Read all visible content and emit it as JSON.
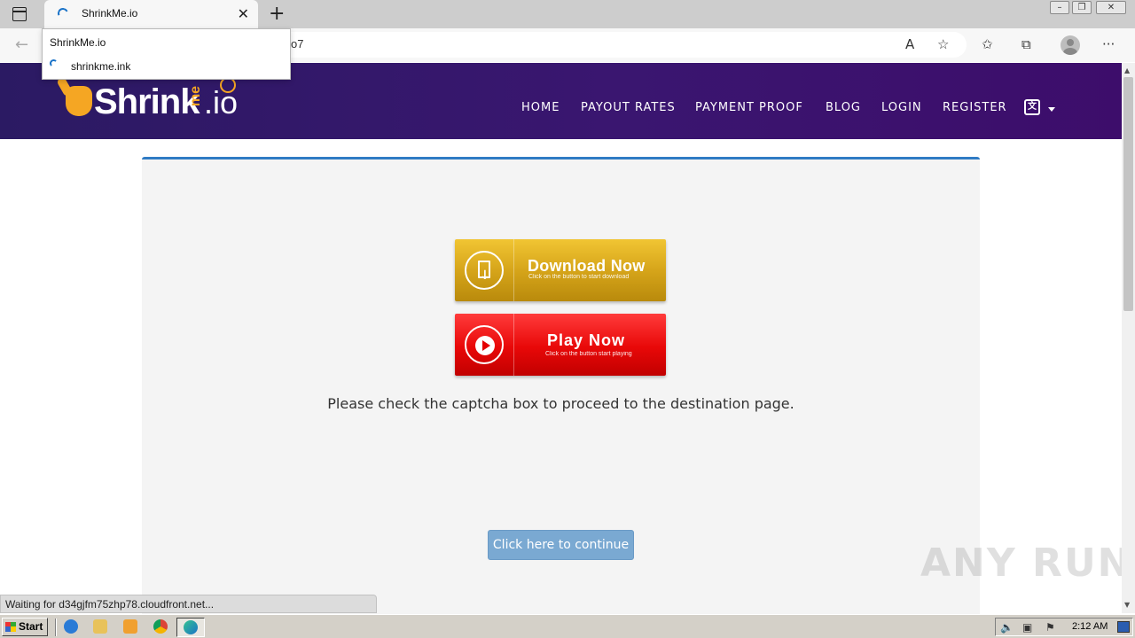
{
  "browser": {
    "tab_title": "ShrinkMe.io",
    "url_fragment": "o7",
    "tooltip": {
      "title": "ShrinkMe.io",
      "domain": "shrinkme.ink"
    },
    "status_text": "Waiting for d34gjfm75zhp78.cloudfront.net..."
  },
  "site": {
    "logo": {
      "main": "Shrink",
      "me": "me",
      "suffix": ".io"
    },
    "nav": [
      "HOME",
      "PAYOUT RATES",
      "PAYMENT PROOF",
      "BLOG",
      "LOGIN",
      "REGISTER"
    ],
    "download_button": {
      "title": "Download Now",
      "subtitle": "Click on the button to start download"
    },
    "play_button": {
      "title": "Play Now",
      "subtitle": "Click on the button start playing"
    },
    "captcha_message": "Please check the captcha box to proceed to the destination page.",
    "continue_label": "Click here to continue",
    "brand_colors": {
      "header_start": "#2b1a63",
      "header_end": "#3d0d6b",
      "accent": "#f5a623",
      "card_border": "#2f7bc4",
      "continue_button": "#7aa9d2"
    }
  },
  "watermark": "ANY RUN",
  "taskbar": {
    "start_label": "Start",
    "clock": "2:12 AM"
  }
}
